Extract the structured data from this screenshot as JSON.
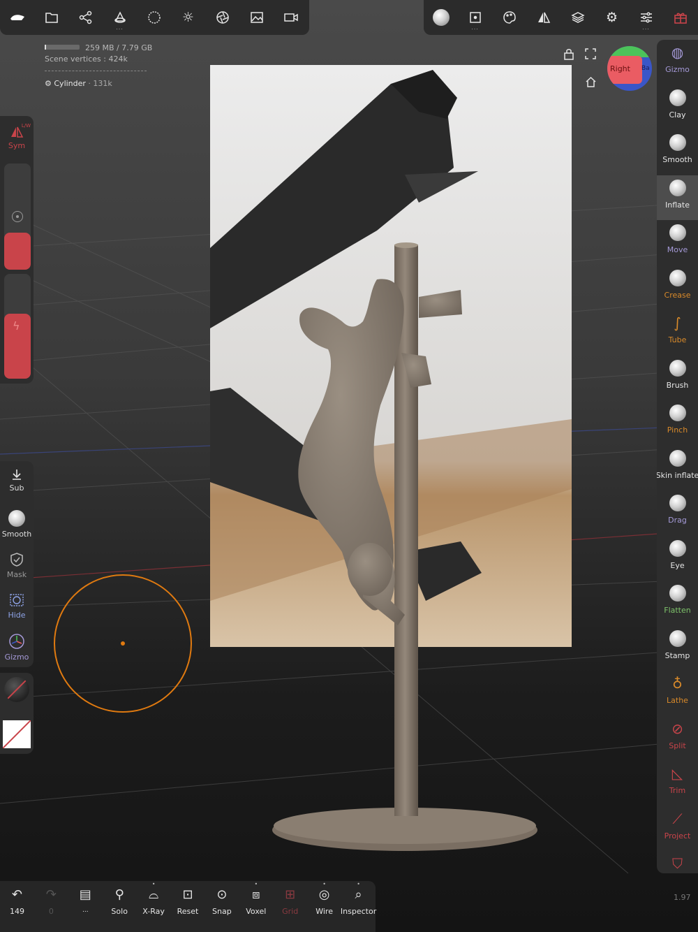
{
  "colors": {
    "accent_red": "#c9444a",
    "brush_circle": "#e07a10",
    "tool_orange": "#d98a2a",
    "tool_purple": "#a59ad8",
    "tool_green": "#7ec36a",
    "panel_bg": "#2d2d2d"
  },
  "top_left_toolbar": [
    {
      "icon": "nomad-logo-icon"
    },
    {
      "icon": "folder-icon"
    },
    {
      "icon": "scene-graph-icon"
    },
    {
      "icon": "shapes-icon",
      "more": "..."
    },
    {
      "icon": "material-sphere-icon"
    },
    {
      "icon": "sun-icon"
    },
    {
      "icon": "camera-aperture-icon"
    },
    {
      "icon": "image-icon"
    },
    {
      "icon": "video-camera-icon"
    }
  ],
  "top_right_toolbar": [
    {
      "icon": "brush-sphere-icon"
    },
    {
      "icon": "stroke-settings-icon",
      "more": "..."
    },
    {
      "icon": "palette-icon"
    },
    {
      "icon": "symmetry-icon"
    },
    {
      "icon": "layers-icon"
    },
    {
      "icon": "settings-gear-icon"
    },
    {
      "icon": "sliders-icon",
      "more": "..."
    },
    {
      "icon": "gift-icon"
    }
  ],
  "info": {
    "memory": "259 MB / 7.79 GB",
    "memory_fraction": 0.04,
    "scene_vertices": "Scene vertices : 424k",
    "selected_object": "Cylinder",
    "selected_vertices": "· 131k"
  },
  "gizmo_cube": {
    "face_label": "Right",
    "side_label": "Ba"
  },
  "right_tools": [
    {
      "label": "Gizmo",
      "color": "#a59ad8",
      "icon": "gizmo-icon"
    },
    {
      "label": "Clay",
      "color": "#e6e6e6",
      "icon": "clay-sphere-icon"
    },
    {
      "label": "Smooth",
      "color": "#e6e6e6",
      "icon": "smooth-sphere-icon"
    },
    {
      "label": "Inflate",
      "color": "#e6e6e6",
      "icon": "inflate-sphere-icon",
      "active": true
    },
    {
      "label": "Move",
      "color": "#a59ad8",
      "icon": "move-sphere-icon"
    },
    {
      "label": "Crease",
      "color": "#d98a2a",
      "icon": "crease-sphere-icon"
    },
    {
      "label": "Tube",
      "color": "#d98a2a",
      "icon": "tube-curve-icon"
    },
    {
      "label": "Brush",
      "color": "#e6e6e6",
      "icon": "brush-sphere-icon"
    },
    {
      "label": "Pinch",
      "color": "#d98a2a",
      "icon": "pinch-sphere-icon"
    },
    {
      "label": "Skin inflate",
      "color": "#e6e6e6",
      "icon": "skin-inflate-sphere-icon"
    },
    {
      "label": "Drag",
      "color": "#a59ad8",
      "icon": "drag-sphere-icon"
    },
    {
      "label": "Eye",
      "color": "#e6e6e6",
      "icon": "eye-sphere-icon"
    },
    {
      "label": "Flatten",
      "color": "#7ec36a",
      "icon": "flatten-sphere-icon"
    },
    {
      "label": "Stamp",
      "color": "#e6e6e6",
      "icon": "stamp-sphere-icon"
    },
    {
      "label": "Lathe",
      "color": "#d98a2a",
      "icon": "lathe-icon"
    },
    {
      "label": "Split",
      "color": "#c9444a",
      "icon": "split-icon"
    },
    {
      "label": "Trim",
      "color": "#c9444a",
      "icon": "trim-icon"
    },
    {
      "label": "Project",
      "color": "#c9444a",
      "icon": "project-icon"
    },
    {
      "label": "",
      "color": "#c9444a",
      "icon": "shield-icon"
    }
  ],
  "left_panel": {
    "sym": {
      "label": "Sym",
      "superscript": "L/W"
    },
    "radius_level": 0.35,
    "intensity_level": 0.62,
    "tools": [
      {
        "label": "Sub",
        "icon": "download-arrow-icon"
      },
      {
        "label": "Smooth",
        "icon": "smooth-sphere-icon"
      },
      {
        "label": "Mask",
        "icon": "mask-shield-icon"
      },
      {
        "label": "Hide",
        "icon": "hide-grid-icon"
      },
      {
        "label": "Gizmo",
        "icon": "gizmo-icon"
      }
    ]
  },
  "bottom_bar": [
    {
      "label": "149",
      "icon": "undo-icon"
    },
    {
      "label": "0",
      "icon": "redo-icon",
      "disabled": true
    },
    {
      "label": "...",
      "icon": "document-icon"
    },
    {
      "label": "Solo",
      "icon": "search-icon"
    },
    {
      "label": "X-Ray",
      "icon": "xray-glasses-icon",
      "more": "•"
    },
    {
      "label": "Reset",
      "icon": "reset-camera-icon"
    },
    {
      "label": "Snap",
      "icon": "snap-camera-icon"
    },
    {
      "label": "Voxel",
      "icon": "voxel-cubes-icon",
      "more": "•"
    },
    {
      "label": "Grid",
      "icon": "grid-icon",
      "disabled": true
    },
    {
      "label": "Wire",
      "icon": "wireframe-sphere-icon",
      "more": "•"
    },
    {
      "label": "Inspector",
      "icon": "inspector-icon",
      "more": "•"
    }
  ],
  "version": "1.97"
}
